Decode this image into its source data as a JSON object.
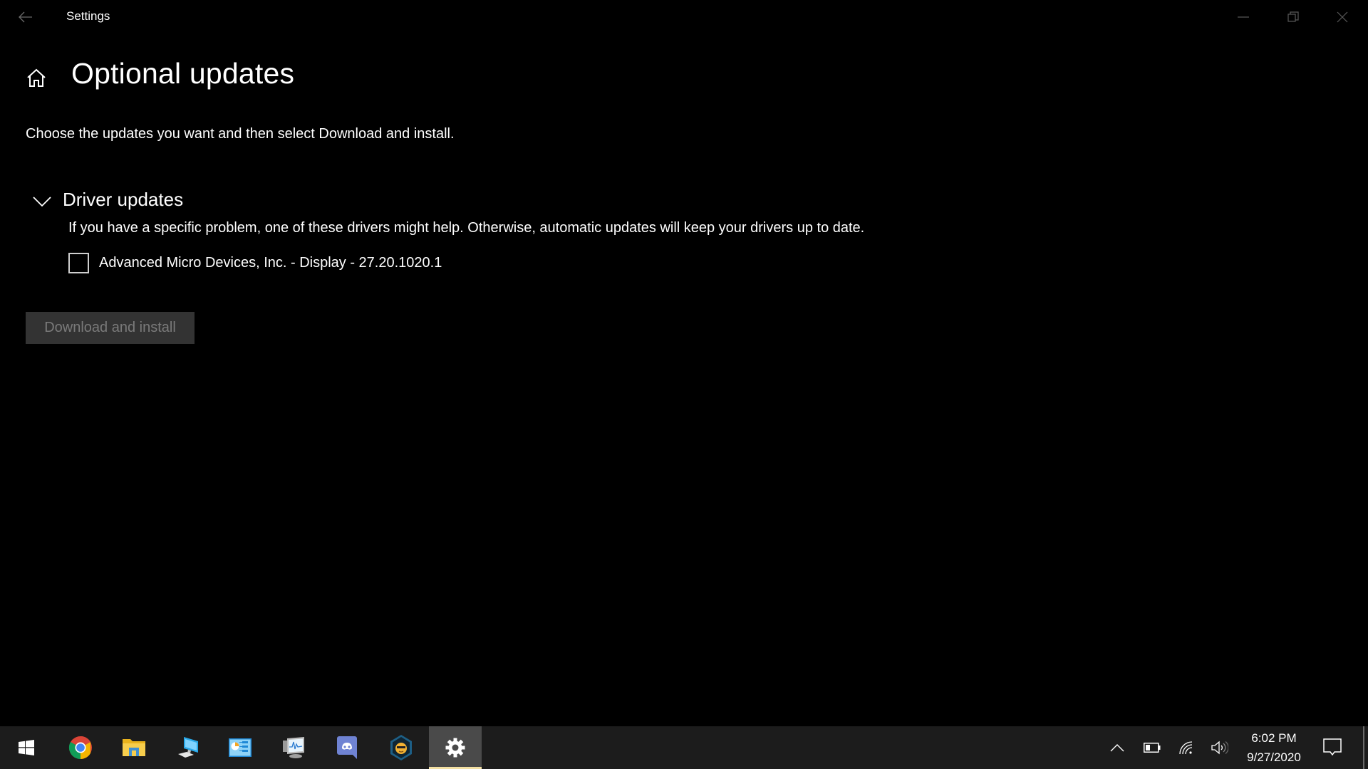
{
  "window": {
    "title": "Settings",
    "controls": {
      "minimize": "minimize-icon",
      "maximize": "restore-icon",
      "close": "close-icon"
    }
  },
  "page": {
    "title": "Optional updates",
    "intro": "Choose the updates you want and then select Download and install.",
    "sections": [
      {
        "heading": "Driver updates",
        "expanded": true,
        "description": "If you have a specific problem, one of these drivers might help. Otherwise, automatic updates will keep your drivers up to date.",
        "items": [
          {
            "label": "Advanced Micro Devices, Inc. - Display - 27.20.1020.1",
            "checked": false
          }
        ]
      }
    ],
    "primary_button": {
      "label": "Download and install",
      "enabled": false
    }
  },
  "taskbar": {
    "pinned": [
      {
        "name": "start",
        "icon": "windows-logo-icon"
      },
      {
        "name": "chrome",
        "icon": "chrome-icon"
      },
      {
        "name": "file-explorer",
        "icon": "folder-icon"
      },
      {
        "name": "this-pc",
        "icon": "computer-icon"
      },
      {
        "name": "control-panel",
        "icon": "control-panel-icon"
      },
      {
        "name": "performance-monitor",
        "icon": "performance-monitor-icon"
      },
      {
        "name": "discord",
        "icon": "discord-icon"
      },
      {
        "name": "security-app",
        "icon": "shield-icon"
      },
      {
        "name": "settings",
        "icon": "gear-icon",
        "active": true
      }
    ],
    "tray": {
      "time": "6:02 PM",
      "date": "9/27/2020",
      "icons": [
        "chevron-up-icon",
        "battery-icon",
        "wifi-icon",
        "volume-icon",
        "notification-icon"
      ]
    }
  },
  "colors": {
    "background": "#000000",
    "taskbar": "#1c1c1c",
    "active_taskbar_button": "#4a4a4a",
    "active_indicator": "#f3e0a4",
    "disabled_button_bg": "#333333",
    "disabled_button_text": "#7a7a7a"
  }
}
